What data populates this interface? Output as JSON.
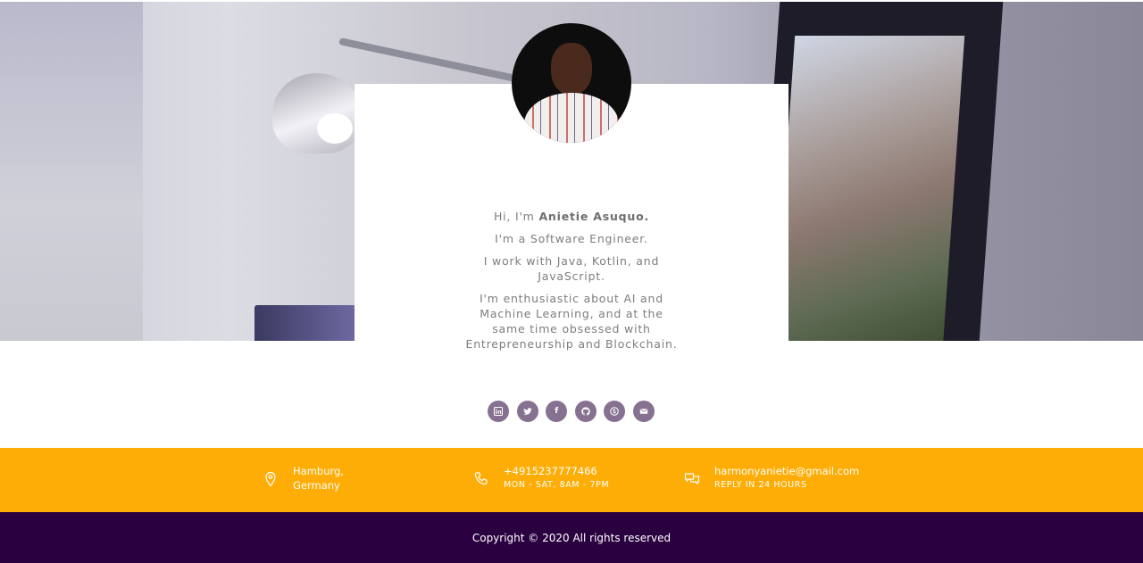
{
  "intro": {
    "greeting_prefix": "Hi, I'm ",
    "name": "Anietie Asuquo.",
    "role": "I'm a Software Engineer.",
    "languages": "I work with Java, Kotlin, and JavaScript.",
    "interests": "I'm enthusiastic about AI and Machine Learning, and at the same time obsessed with Entrepreneurship and Blockchain."
  },
  "socials": [
    {
      "name": "linkedin",
      "icon": "linkedin-icon"
    },
    {
      "name": "twitter",
      "icon": "twitter-icon"
    },
    {
      "name": "facebook",
      "icon": "facebook-icon",
      "glyph": "f"
    },
    {
      "name": "github",
      "icon": "github-icon"
    },
    {
      "name": "skype",
      "icon": "skype-icon"
    },
    {
      "name": "email",
      "icon": "mail-icon"
    }
  ],
  "contact": {
    "location": {
      "line1": "Hamburg,",
      "line2": "Germany",
      "icon": "map-pin-icon"
    },
    "phone": {
      "number": "+4915237777466",
      "hours": "MON - SAT, 8AM - 7PM",
      "icon": "phone-icon"
    },
    "email": {
      "address": "harmonyanietie@gmail.com",
      "note": "REPLY IN 24 HOURS",
      "icon": "chat-icon"
    }
  },
  "footer": {
    "copyright": "Copyright © 2020 All rights reserved"
  },
  "colors": {
    "accent": "#fdad06",
    "footer_bg": "#2a0040",
    "social_bg": "#877190"
  }
}
